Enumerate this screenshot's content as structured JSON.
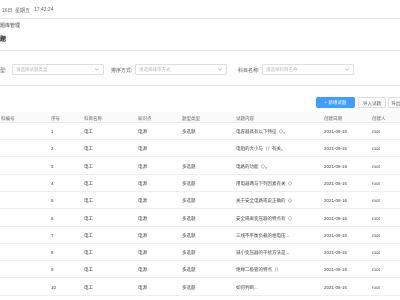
{
  "topbar": {
    "date": "16日",
    "weekday": "星期五",
    "time": "17:42:24"
  },
  "breadcrumb": "题库管理",
  "page_title": "题",
  "filters": [
    {
      "label": "型:",
      "placeholder": "请选择试题类型"
    },
    {
      "label": "排序方式:",
      "placeholder": "请选择排序方式"
    },
    {
      "label": "科目名称:",
      "placeholder": "请选择科目名称"
    }
  ],
  "actions": {
    "add": "+ 新增试题",
    "import": "导入试题",
    "export": "导出试"
  },
  "table": {
    "headers": [
      "科编号",
      "序号",
      "科目名称",
      "知识点",
      "题型类型",
      "试题内容",
      "创建日期",
      "创建人"
    ],
    "rows": [
      {
        "index": "1",
        "subject": "电工",
        "point": "电源",
        "type": "多选题",
        "content": "电容器具有以下特征（）。",
        "date": "2021-08-16",
        "creator": "root"
      },
      {
        "index": "2",
        "subject": "电工",
        "point": "电源",
        "type": "",
        "content": "电阻的大小与（）有关。",
        "date": "2021-08-16",
        "creator": "root"
      },
      {
        "index": "3",
        "subject": "电工",
        "point": "电源",
        "type": "多选题",
        "content": "电路的功能（）。",
        "date": "2021-08-16",
        "creator": "root"
      },
      {
        "index": "4",
        "subject": "电工",
        "point": "电源",
        "type": "多选题",
        "content": "用电器两与下列因素有关（）",
        "date": "2021-08-16",
        "creator": "root"
      },
      {
        "index": "5",
        "subject": "电工",
        "point": "电源",
        "type": "多选题",
        "content": "关于安全电路或说正确的（）",
        "date": "2021-08-16",
        "creator": "root"
      },
      {
        "index": "6",
        "subject": "电工",
        "point": "电源",
        "type": "多选题",
        "content": "安全隔离变压器的特点有（）",
        "date": "2021-08-16",
        "creator": "root"
      },
      {
        "index": "7",
        "subject": "电工",
        "point": "电源",
        "type": "多选题",
        "content": "三线不平衡负载的相电压...",
        "date": "2021-08-16",
        "creator": "root"
      },
      {
        "index": "8",
        "subject": "电工",
        "point": "电源",
        "type": "多选题",
        "content": "减小变压器的干扰方法是...",
        "date": "2021-08-16",
        "creator": "root"
      },
      {
        "index": "9",
        "subject": "电工",
        "point": "电源",
        "type": "多选题",
        "content": "绝缘二极管的特点（）",
        "date": "2021-08-16",
        "creator": "root"
      },
      {
        "index": "10",
        "subject": "电工",
        "point": "电源",
        "type": "多选题",
        "content": "如何判断...",
        "date": "2021-08-16",
        "creator": "root"
      }
    ]
  }
}
